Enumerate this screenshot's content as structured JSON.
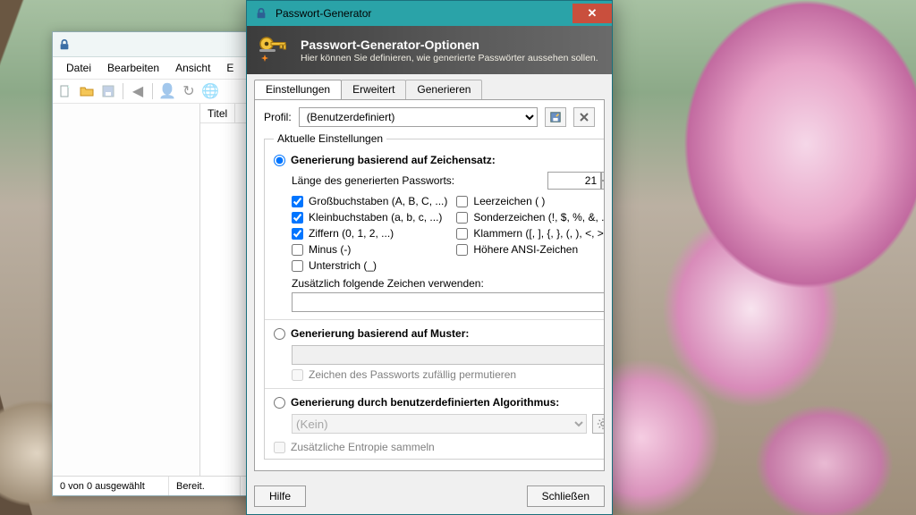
{
  "mainWindow": {
    "menus": {
      "file": "Datei",
      "edit": "Bearbeiten",
      "view": "Ansicht",
      "extras_prefix": "E"
    },
    "listHeader": {
      "title": "Titel"
    },
    "status": {
      "selection": "0 von 0 ausgewählt",
      "ready": "Bereit."
    }
  },
  "dialog": {
    "title": "Passwort-Generator",
    "closeGlyph": "✕",
    "banner": {
      "heading": "Passwort-Generator-Optionen",
      "sub": "Hier können Sie definieren, wie generierte Passwörter aussehen sollen."
    },
    "tabs": {
      "settings": "Einstellungen",
      "advanced": "Erweitert",
      "generate": "Generieren"
    },
    "profileLabel": "Profil:",
    "profileValue": "(Benutzerdefiniert)",
    "groupLegend": "Aktuelle Einstellungen",
    "radioCharset": "Generierung basierend auf Zeichensatz:",
    "lengthLabel": "Länge des generierten Passworts:",
    "lengthValue": "21",
    "checks": {
      "upper": "Großbuchstaben (A, B, C, ...)",
      "lower": "Kleinbuchstaben (a, b, c, ...)",
      "digits": "Ziffern (0, 1, 2, ...)",
      "minus": "Minus (-)",
      "underscore": "Unterstrich (_)",
      "space": "Leerzeichen ( )",
      "special": "Sonderzeichen (!, $, %, &, ...)",
      "brackets": "Klammern ([, ], {, }, (, ), <, >)",
      "ansi": "Höhere ANSI-Zeichen"
    },
    "extraCharsLabel": "Zusätzlich folgende Zeichen verwenden:",
    "extraCharsValue": "",
    "radioPattern": "Generierung basierend auf Muster:",
    "permuteLabel": "Zeichen des Passworts zufällig permutieren",
    "radioAlgo": "Generierung durch benutzerdefinierten Algorithmus:",
    "algoValue": "(Kein)",
    "entropyLabel": "Zusätzliche Entropie sammeln",
    "buttons": {
      "help": "Hilfe",
      "close": "Schließen"
    }
  }
}
